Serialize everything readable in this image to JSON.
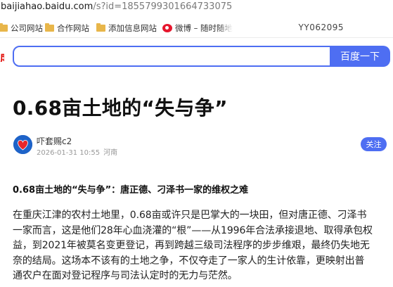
{
  "browser": {
    "address_host": "baijiahao.baidu.com",
    "address_path": "/s?id=1855799301664733075"
  },
  "bookmarks": {
    "items": [
      {
        "label": "公司网站",
        "icon": "folder-icon"
      },
      {
        "label": "合作网站",
        "icon": "folder-icon"
      },
      {
        "label": "添加信息网站",
        "icon": "folder-icon"
      },
      {
        "label": "微博 – 随时随地",
        "icon": "weibo-icon"
      }
    ],
    "right_label": "YY062095"
  },
  "search": {
    "value": "",
    "button_label": "百度一下"
  },
  "article": {
    "title": "0.68亩土地的“失与争”",
    "author": {
      "name": "吓套赐c2",
      "date": "2026-01-31 10:55",
      "location": "河南",
      "follow_label": "关注"
    },
    "subhead": "0.68亩土地的“失与争”：唐正德、刁泽书一家的维权之难",
    "paragraph_lines": [
      "在重庆江津的农村土地里，0.68亩或许只是巴掌大的一块田，但对唐正德、刁泽书",
      "一家而言，这是他们28年心血浇灌的“根”——从1996年合法承接退地、取得承包权",
      "益，到2021年被莫名变更登记，再到跨越三级司法程序的步步维艰，最终仍失地无",
      "奈的结局。这场本不该有的土地之争，不仅夺走了一家人的生计依靠，更映射出普",
      "通农户在面对登记程序与司法认定时的无力与茫然。"
    ]
  },
  "colors": {
    "accent": "#4e6ef2",
    "folder": "#e8b64a",
    "weibo": "#e6162d"
  }
}
